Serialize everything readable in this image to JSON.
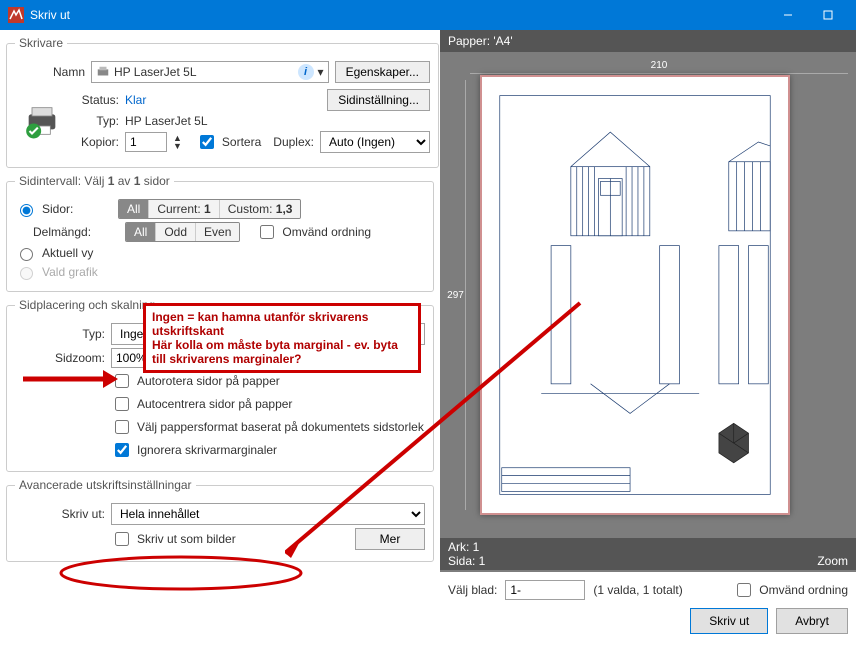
{
  "title": "Skriv ut",
  "printer_group": {
    "legend": "Skrivare",
    "name_label": "Namn",
    "name_value": "HP LaserJet 5L",
    "properties_btn": "Egenskaper...",
    "status_label": "Status:",
    "status_value": "Klar",
    "page_setup_btn": "Sidinställning...",
    "type_label": "Typ:",
    "type_value": "HP LaserJet 5L",
    "copies_label": "Kopior:",
    "copies_value": "1",
    "collate_label": "Sortera",
    "duplex_label": "Duplex:",
    "duplex_value": "Auto (Ingen)"
  },
  "range_group": {
    "legend_prefix": "Sidintervall: Välj ",
    "legend_bold1": "1",
    "legend_mid": " av ",
    "legend_bold2": "1",
    "legend_suffix": " sidor",
    "pages_label": "Sidor:",
    "all": "All",
    "current": "Current:",
    "current_val": "1",
    "custom": "Custom:",
    "custom_val": "1,3",
    "subset_label": "Delmängd:",
    "odd": "Odd",
    "even": "Even",
    "reverse_label": "Omvänd ordning",
    "current_view_label": "Aktuell vy",
    "selected_graphic_label": "Vald grafik"
  },
  "placement_group": {
    "legend": "Sidplacering och skalning",
    "type_label": "Typ:",
    "type_value": "Ingen",
    "zoom_label": "Sidzoom:",
    "zoom_value": "100%",
    "autorotate": "Autorotera sidor på papper",
    "autocenter": "Autocentrera sidor på papper",
    "papersize_doc": "Välj pappersformat baserat på dokumentets sidstorlek",
    "ignore_margins": "Ignorera skrivarmarginaler"
  },
  "advanced_group": {
    "legend": "Avancerade utskriftsinställningar",
    "print_label": "Skriv ut:",
    "print_value": "Hela innehållet",
    "print_as_images": "Skriv ut som bilder",
    "more_btn": "Mer"
  },
  "annotation": {
    "line1": "Ingen = kan hamna utanför skrivarens utskriftskant",
    "line2": "Här kolla om måste byta marginal - ev. byta till skrivarens marginaler?"
  },
  "preview": {
    "paper_label": "Papper: 'A4'",
    "width_mm": "210",
    "height_mm": "297",
    "ark_label": "Ark: 1",
    "sida_label": "Sida: 1",
    "zoom_label": "Zoom"
  },
  "bottom": {
    "select_sheet_label": "Välj blad:",
    "select_sheet_value": "1-",
    "selected_count": "(1 valda, 1 totalt)",
    "reverse_label": "Omvänd ordning",
    "print_btn": "Skriv ut",
    "cancel_btn": "Avbryt"
  }
}
